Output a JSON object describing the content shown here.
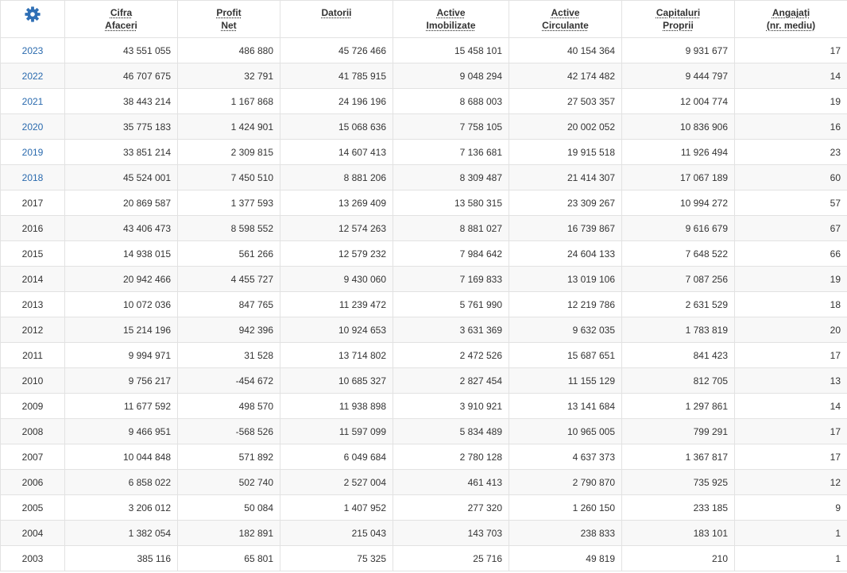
{
  "colors": {
    "link": "#2a6aae",
    "icon": "#2f6fb5",
    "text": "#333333",
    "border": "#e2e2e2",
    "stripe": "#f8f8f8"
  },
  "settings": {
    "icon": "gear-icon"
  },
  "header": {
    "columns": [
      {
        "line1": "Cifra",
        "line2": "Afaceri"
      },
      {
        "line1": "Profit",
        "line2": "Net"
      },
      {
        "line1": "Datorii"
      },
      {
        "line1": "Active",
        "line2": "Imobilizate"
      },
      {
        "line1": "Active",
        "line2": "Circulante"
      },
      {
        "line1": "Capitaluri",
        "line2": "Proprii"
      },
      {
        "line1": "Angajați",
        "line2": "(nr. mediu)"
      }
    ]
  },
  "rows": [
    {
      "year": "2023",
      "is_link": true,
      "values": [
        "43 551 055",
        "486 880",
        "45 726 466",
        "15 458 101",
        "40 154 364",
        "9 931 677",
        "17"
      ]
    },
    {
      "year": "2022",
      "is_link": true,
      "values": [
        "46 707 675",
        "32 791",
        "41 785 915",
        "9 048 294",
        "42 174 482",
        "9 444 797",
        "14"
      ]
    },
    {
      "year": "2021",
      "is_link": true,
      "values": [
        "38 443 214",
        "1 167 868",
        "24 196 196",
        "8 688 003",
        "27 503 357",
        "12 004 774",
        "19"
      ]
    },
    {
      "year": "2020",
      "is_link": true,
      "values": [
        "35 775 183",
        "1 424 901",
        "15 068 636",
        "7 758 105",
        "20 002 052",
        "10 836 906",
        "16"
      ]
    },
    {
      "year": "2019",
      "is_link": true,
      "values": [
        "33 851 214",
        "2 309 815",
        "14 607 413",
        "7 136 681",
        "19 915 518",
        "11 926 494",
        "23"
      ]
    },
    {
      "year": "2018",
      "is_link": true,
      "values": [
        "45 524 001",
        "7 450 510",
        "8 881 206",
        "8 309 487",
        "21 414 307",
        "17 067 189",
        "60"
      ]
    },
    {
      "year": "2017",
      "is_link": false,
      "values": [
        "20 869 587",
        "1 377 593",
        "13 269 409",
        "13 580 315",
        "23 309 267",
        "10 994 272",
        "57"
      ]
    },
    {
      "year": "2016",
      "is_link": false,
      "values": [
        "43 406 473",
        "8 598 552",
        "12 574 263",
        "8 881 027",
        "16 739 867",
        "9 616 679",
        "67"
      ]
    },
    {
      "year": "2015",
      "is_link": false,
      "values": [
        "14 938 015",
        "561 266",
        "12 579 232",
        "7 984 642",
        "24 604 133",
        "7 648 522",
        "66"
      ]
    },
    {
      "year": "2014",
      "is_link": false,
      "values": [
        "20 942 466",
        "4 455 727",
        "9 430 060",
        "7 169 833",
        "13 019 106",
        "7 087 256",
        "19"
      ]
    },
    {
      "year": "2013",
      "is_link": false,
      "values": [
        "10 072 036",
        "847 765",
        "11 239 472",
        "5 761 990",
        "12 219 786",
        "2 631 529",
        "18"
      ]
    },
    {
      "year": "2012",
      "is_link": false,
      "values": [
        "15 214 196",
        "942 396",
        "10 924 653",
        "3 631 369",
        "9 632 035",
        "1 783 819",
        "20"
      ]
    },
    {
      "year": "2011",
      "is_link": false,
      "values": [
        "9 994 971",
        "31 528",
        "13 714 802",
        "2 472 526",
        "15 687 651",
        "841 423",
        "17"
      ]
    },
    {
      "year": "2010",
      "is_link": false,
      "values": [
        "9 756 217",
        "-454 672",
        "10 685 327",
        "2 827 454",
        "11 155 129",
        "812 705",
        "13"
      ]
    },
    {
      "year": "2009",
      "is_link": false,
      "values": [
        "11 677 592",
        "498 570",
        "11 938 898",
        "3 910 921",
        "13 141 684",
        "1 297 861",
        "14"
      ]
    },
    {
      "year": "2008",
      "is_link": false,
      "values": [
        "9 466 951",
        "-568 526",
        "11 597 099",
        "5 834 489",
        "10 965 005",
        "799 291",
        "17"
      ]
    },
    {
      "year": "2007",
      "is_link": false,
      "values": [
        "10 044 848",
        "571 892",
        "6 049 684",
        "2 780 128",
        "4 637 373",
        "1 367 817",
        "17"
      ]
    },
    {
      "year": "2006",
      "is_link": false,
      "values": [
        "6 858 022",
        "502 740",
        "2 527 004",
        "461 413",
        "2 790 870",
        "735 925",
        "12"
      ]
    },
    {
      "year": "2005",
      "is_link": false,
      "values": [
        "3 206 012",
        "50 084",
        "1 407 952",
        "277 320",
        "1 260 150",
        "233 185",
        "9"
      ]
    },
    {
      "year": "2004",
      "is_link": false,
      "values": [
        "1 382 054",
        "182 891",
        "215 043",
        "143 703",
        "238 833",
        "183 101",
        "1"
      ]
    },
    {
      "year": "2003",
      "is_link": false,
      "values": [
        "385 116",
        "65 801",
        "75 325",
        "25 716",
        "49 819",
        "210",
        "1"
      ]
    }
  ]
}
